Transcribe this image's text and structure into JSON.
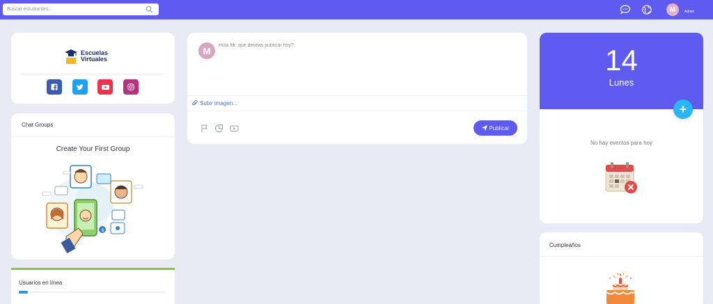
{
  "topbar": {
    "search_placeholder": "Buscar estudiantes...",
    "user_initial": "M",
    "user_label": "Admin"
  },
  "brand": {
    "logo_text_line1": "Escuelas",
    "logo_text_line2": "Virtuales",
    "social": [
      {
        "name": "facebook",
        "color": "#3b5bb5"
      },
      {
        "name": "twitter",
        "color": "#1da1f2"
      },
      {
        "name": "youtube",
        "color": "#f0324f"
      },
      {
        "name": "instagram",
        "color": "#b7327c"
      }
    ]
  },
  "chat_groups": {
    "title": "Chat Groups",
    "empty_text": "Create Your First Group"
  },
  "online_users": {
    "title": "Usuarios en línea"
  },
  "post": {
    "avatar_initial": "M",
    "placeholder": "Hola Mr. qué deseas publicar hoy?",
    "upload_label": "Subir imagen...",
    "publish_label": "Publicar"
  },
  "events": {
    "day_number": "14",
    "day_name": "Lunes",
    "add_label": "+",
    "empty_text": "No hay eventos para hoy"
  },
  "birthdays": {
    "title": "Cumpleaños"
  },
  "colors": {
    "primary": "#5f5bf0",
    "accent": "#29b6f6",
    "online": "#8bc34a"
  }
}
